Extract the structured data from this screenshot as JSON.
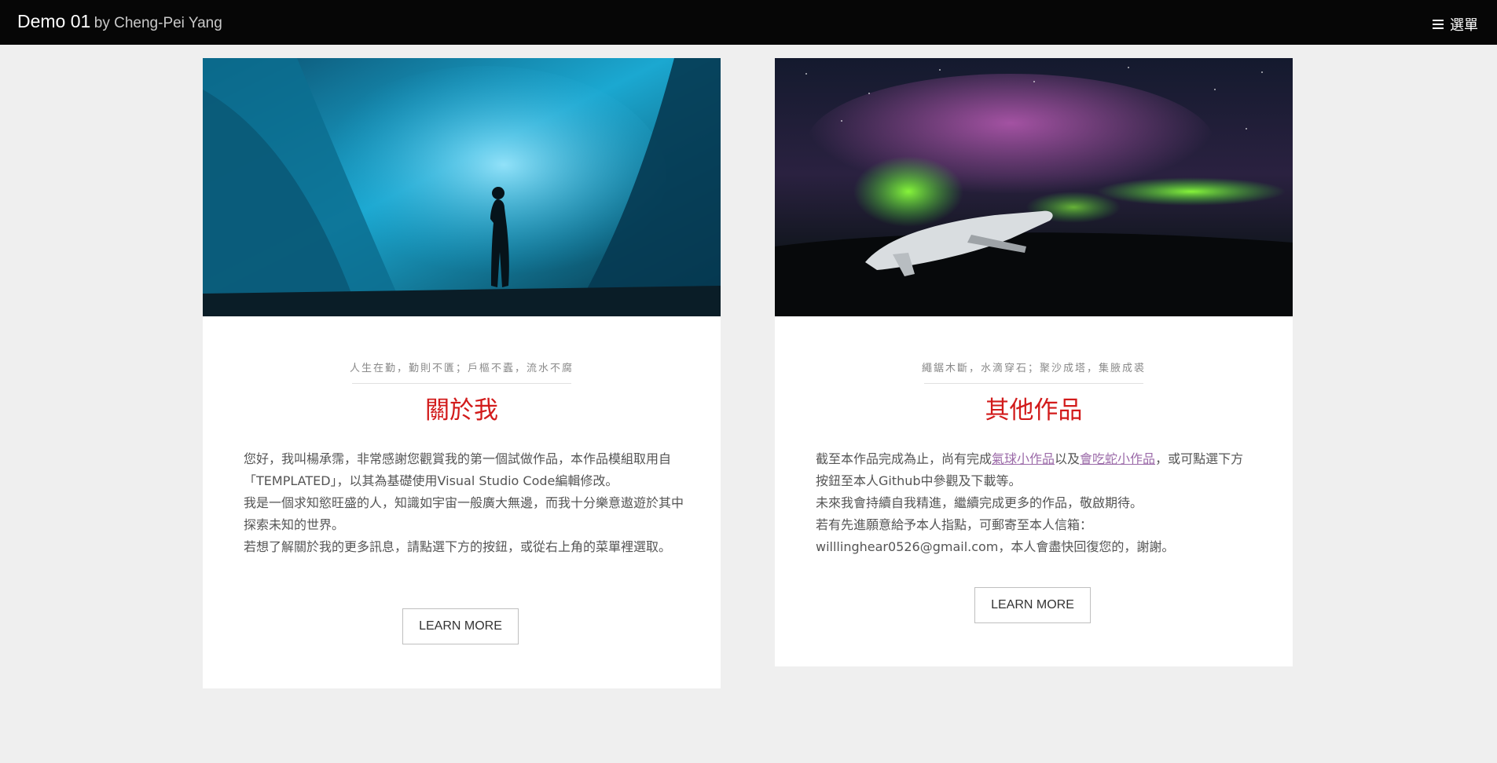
{
  "header": {
    "title": "Demo 01",
    "byline": "by Cheng-Pei Yang",
    "menu_label": "選單",
    "menu_icon": "hamburger-icon"
  },
  "colors": {
    "topbar_bg": "#060606",
    "heading_red": "#d21b1b",
    "link_purple": "#9b6aa8",
    "page_bg": "#efefef"
  },
  "cards": [
    {
      "image_subject": "ice-cave-silhouette",
      "tagline": "人生在勤，勤則不匱；戶樞不蠹，流水不腐",
      "heading": "關於我",
      "paragraphs": [
        "您好，我叫楊承霈，非常感謝您觀賞我的第一個試做作品，本作品模組取用自「TEMPLATED」，以其為基礎使用Visual Studio Code編輯修改。",
        "我是一個求知慾旺盛的人，知識如宇宙一般廣大無邊，而我十分樂意遨遊於其中探索未知的世界。",
        "若想了解關於我的更多訊息，請點選下方的按鈕，或從右上角的菜單裡選取。"
      ],
      "button_label": "LEARN MORE"
    },
    {
      "image_subject": "aurora-plane-wreck",
      "tagline": "繩鋸木斷，水滴穿石；聚沙成塔，集腋成裘",
      "heading": "其他作品",
      "p1_start": "截至本作品完成為止，尚有完成",
      "link1": "氣球小作品",
      "p1_mid": "以及",
      "link2": "會吃蛇小作品",
      "p1_end": "，或可點選下方按鈕至本人Github中參觀及下載等。",
      "p2": "未來我會持續自我精進，繼續完成更多的作品，敬啟期待。",
      "p3": "若有先進願意給予本人指點，可郵寄至本人信箱：",
      "p4": "willlinghear0526@gmail.com，本人會盡快回復您的，謝謝。",
      "button_label": "LEARN MORE"
    }
  ]
}
